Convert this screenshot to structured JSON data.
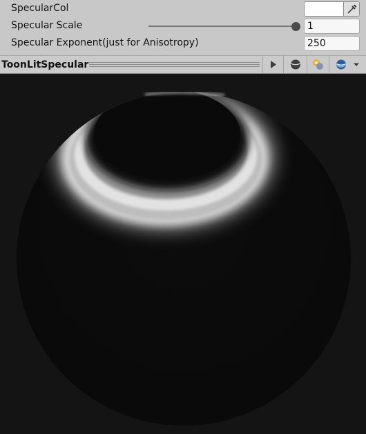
{
  "inspector": {
    "specular_color": {
      "label": "SpecularCol",
      "value": "#ffffff"
    },
    "specular_scale": {
      "label": "Specular Scale",
      "value": "1"
    },
    "specular_exponent": {
      "label": "Specular Exponent(just for Anisotropy)",
      "value": "250"
    }
  },
  "preview": {
    "title": "ToonLitSpecular",
    "toolbar_icons": [
      "play-icon",
      "sphere-icon",
      "light-icon",
      "mesh-icon",
      "dropdown-arrow-icon"
    ]
  }
}
